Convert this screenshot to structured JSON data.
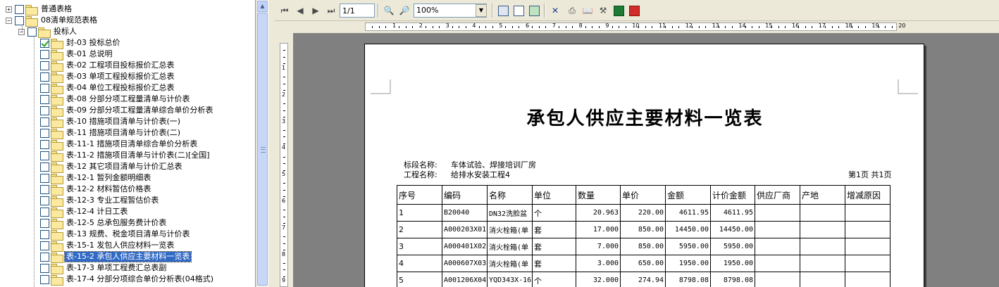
{
  "tree": {
    "items": [
      {
        "label": "普通表格",
        "level": 0,
        "expander": "+",
        "checked": false
      },
      {
        "label": "08清单规范表格",
        "level": 0,
        "expander": "−",
        "checked": false
      },
      {
        "label": "投标人",
        "level": 1,
        "expander": "−",
        "checked": false
      },
      {
        "label": "封-03 投标总价",
        "level": 2,
        "checked": true
      },
      {
        "label": "表-01 总说明",
        "level": 2,
        "checked": false
      },
      {
        "label": "表-02 工程项目投标报价汇总表",
        "level": 2,
        "checked": false
      },
      {
        "label": "表-03 单项工程投标报价汇总表",
        "level": 2,
        "checked": false
      },
      {
        "label": "表-04 单位工程投标报价汇总表",
        "level": 2,
        "checked": false
      },
      {
        "label": "表-08 分部分项工程量清单与计价表",
        "level": 2,
        "checked": false
      },
      {
        "label": "表-09 分部分项工程量清单综合单价分析表",
        "level": 2,
        "checked": false
      },
      {
        "label": "表-10 措施项目清单与计价表(一)",
        "level": 2,
        "checked": false
      },
      {
        "label": "表-11 措施项目清单与计价表(二)",
        "level": 2,
        "checked": false
      },
      {
        "label": "表-11-1 措施项目清单综合单价分析表",
        "level": 2,
        "checked": false
      },
      {
        "label": "表-11-2 措施项目清单与计价表(二)[全国]",
        "level": 2,
        "checked": false
      },
      {
        "label": "表-12 其它项目清单与计价汇总表",
        "level": 2,
        "checked": false
      },
      {
        "label": "表-12-1 暂列金额明细表",
        "level": 2,
        "checked": false
      },
      {
        "label": "表-12-2 材料暂估价格表",
        "level": 2,
        "checked": false
      },
      {
        "label": "表-12-3 专业工程暂估价表",
        "level": 2,
        "checked": false
      },
      {
        "label": "表-12-4 计日工表",
        "level": 2,
        "checked": false
      },
      {
        "label": "表-12-5 总承包服务费计价表",
        "level": 2,
        "checked": false
      },
      {
        "label": "表-13 规费、税金项目清单与计价表",
        "level": 2,
        "checked": false
      },
      {
        "label": "表-15-1 发包人供应材料一览表",
        "level": 2,
        "checked": false
      },
      {
        "label": "表-15-2 承包人供应主要材料一览表",
        "level": 2,
        "checked": false,
        "selected": true
      },
      {
        "label": "表-17-3 单项工程费汇总表副",
        "level": 2,
        "checked": false
      },
      {
        "label": "表-17-4 分部分项综合单价分析表(04格式)",
        "level": 2,
        "checked": false
      }
    ]
  },
  "toolbar": {
    "page_value": "1/1",
    "zoom_value": "100%",
    "icons": [
      "first-page-icon",
      "prev-page-icon",
      "next-page-icon",
      "last-page-icon",
      "zoom-in-icon",
      "zoom-out-icon",
      "save-icon",
      "page-setup-icon",
      "export-icon",
      "close-icon",
      "print-icon",
      "book-icon",
      "tools-icon",
      "excel-icon",
      "pdf-icon"
    ]
  },
  "ruler": {
    "h_labels": [
      "1",
      "2",
      "3",
      "4",
      "5",
      "6",
      "7",
      "8",
      "9",
      "10",
      "11",
      "12",
      "13",
      "14",
      "15",
      "16",
      "17",
      "18",
      "19",
      "20"
    ],
    "v_labels": [
      "1",
      "2",
      "3",
      "4",
      "5",
      "6",
      "7",
      "8",
      "9"
    ]
  },
  "document": {
    "title": "承包人供应主要材料一览表",
    "section_label": "标段名称:",
    "section_value": "车体试验、焊接培训厂房",
    "project_label": "工程名称:",
    "project_value": "给排水安装工程4",
    "page_info": "第1页 共1页",
    "columns": [
      "序号",
      "编码",
      "名称",
      "单位",
      "数量",
      "单价",
      "金额",
      "计价金额",
      "供应厂商",
      "产地",
      "增减原因"
    ],
    "rows": [
      [
        "1",
        "B20040",
        "DN32洗脸盆",
        "个",
        "20.963",
        "220.00",
        "4611.95",
        "4611.95",
        "",
        "",
        ""
      ],
      [
        "2",
        "A000203X01",
        "消火栓箱(单",
        "套",
        "17.000",
        "850.00",
        "14450.00",
        "14450.00",
        "",
        "",
        ""
      ],
      [
        "3",
        "A000401X02",
        "消火栓箱(单",
        "套",
        "7.000",
        "850.00",
        "5950.00",
        "5950.00",
        "",
        "",
        ""
      ],
      [
        "4",
        "A000607X03",
        "消火栓箱(单",
        "套",
        "3.000",
        "650.00",
        "1950.00",
        "1950.00",
        "",
        "",
        ""
      ],
      [
        "5",
        "A001206X04",
        "YQD343X-16",
        "个",
        "32.000",
        "274.94",
        "8798.08",
        "8798.08",
        "",
        "",
        ""
      ]
    ]
  },
  "colors": {
    "selection": "#316ac5",
    "canvas_bg": "#808080",
    "chrome_bg": "#ece9d8"
  }
}
